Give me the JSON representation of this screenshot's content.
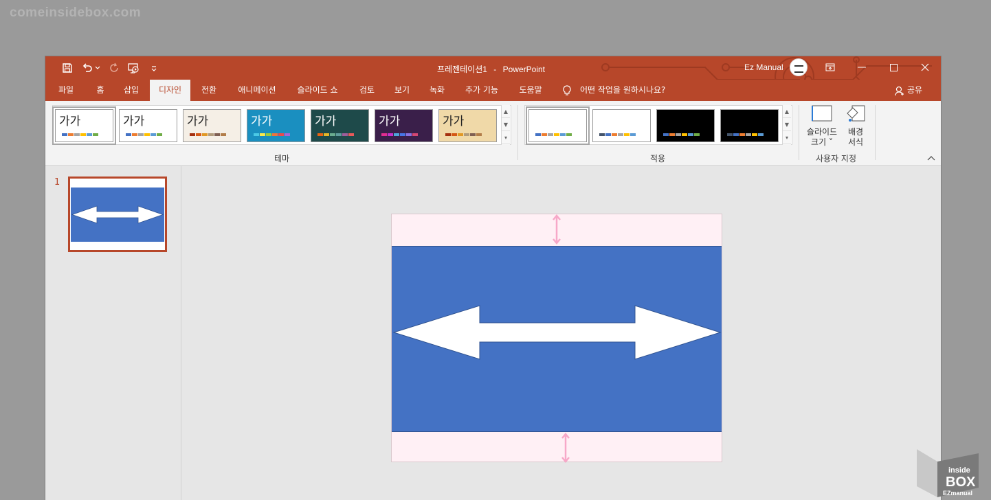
{
  "watermark_top": "comeinsidebox.com",
  "window": {
    "document_title": "프레젠테이션1",
    "separator": "-",
    "app_name": "PowerPoint",
    "user_name": "Ez Manual"
  },
  "tabs": [
    {
      "label": "파일"
    },
    {
      "label": "홈"
    },
    {
      "label": "삽입"
    },
    {
      "label": "디자인",
      "active": true
    },
    {
      "label": "전환"
    },
    {
      "label": "애니메이션"
    },
    {
      "label": "슬라이드 쇼"
    },
    {
      "label": "검토"
    },
    {
      "label": "보기"
    },
    {
      "label": "녹화"
    },
    {
      "label": "추가 기능"
    },
    {
      "label": "도움말"
    }
  ],
  "tell_me": "어떤 작업을 원하시나요?",
  "share": "공유",
  "ribbon": {
    "themes": {
      "label": "테마",
      "thumb_text": "가가",
      "items": [
        {
          "name": "office",
          "bg": "#ffffff",
          "colors": [
            "#4472c4",
            "#ed7d31",
            "#a5a5a5",
            "#ffc000",
            "#5b9bd5",
            "#70ad47"
          ]
        },
        {
          "name": "office-theme-2",
          "bg": "#ffffff",
          "colors": [
            "#4472c4",
            "#ed7d31",
            "#a5a5a5",
            "#ffc000",
            "#5b9bd5",
            "#70ad47"
          ]
        },
        {
          "name": "facet",
          "bg": "#f5efe6",
          "colors": [
            "#a5300f",
            "#d55816",
            "#e19825",
            "#b19c7d",
            "#7f5f52",
            "#b27d49"
          ]
        },
        {
          "name": "ion",
          "bg": "#1a8fc0",
          "colors": [
            "#4bc9e6",
            "#f7e94e",
            "#9bcb3c",
            "#f0733c",
            "#e84c4c",
            "#a366d6"
          ]
        },
        {
          "name": "organic",
          "bg": "#1e4a4a",
          "colors": [
            "#ea6312",
            "#e6b729",
            "#6aac90",
            "#5f9c9d",
            "#9e5e9b",
            "#e85a5a"
          ]
        },
        {
          "name": "retrospect",
          "bg": "#3a1f4a",
          "colors": [
            "#e32d91",
            "#c830cc",
            "#4ea6dc",
            "#4775e7",
            "#8971e1",
            "#d54773"
          ]
        },
        {
          "name": "slice",
          "bg": "#f0d9a8",
          "colors": [
            "#a5300f",
            "#d55816",
            "#e19825",
            "#b19c7d",
            "#7f5f52",
            "#b27d49"
          ]
        }
      ]
    },
    "variants": {
      "label": "적용",
      "items": [
        {
          "bg": "#ffffff",
          "colors": [
            "#4472c4",
            "#ed7d31",
            "#a5a5a5",
            "#ffc000",
            "#5b9bd5",
            "#70ad47"
          ]
        },
        {
          "bg": "#ffffff",
          "colors": [
            "#44546a",
            "#4472c4",
            "#ed7d31",
            "#a5a5a5",
            "#ffc000",
            "#5b9bd5"
          ]
        },
        {
          "bg": "#000000",
          "colors": [
            "#4472c4",
            "#ed7d31",
            "#a5a5a5",
            "#ffc000",
            "#5b9bd5",
            "#70ad47"
          ]
        },
        {
          "bg": "#000000",
          "colors": [
            "#44546a",
            "#4472c4",
            "#ed7d31",
            "#a5a5a5",
            "#ffc000",
            "#5b9bd5"
          ]
        }
      ]
    },
    "customize": {
      "label": "사용자 지정",
      "slide_size_line1": "슬라이드",
      "slide_size_line2": "크기",
      "format_bg_line1": "배경",
      "format_bg_line2": "서식"
    }
  },
  "slides": {
    "thumb_number": "1"
  },
  "watermark_br": {
    "line1": "inside",
    "line2": "BOX",
    "line3": "EZmanual"
  },
  "colors": {
    "accent": "#b7472a",
    "slide_band": "#4472c4",
    "slide_bg": "#fff0f5",
    "arrow_pink": "#f7a8c8"
  }
}
